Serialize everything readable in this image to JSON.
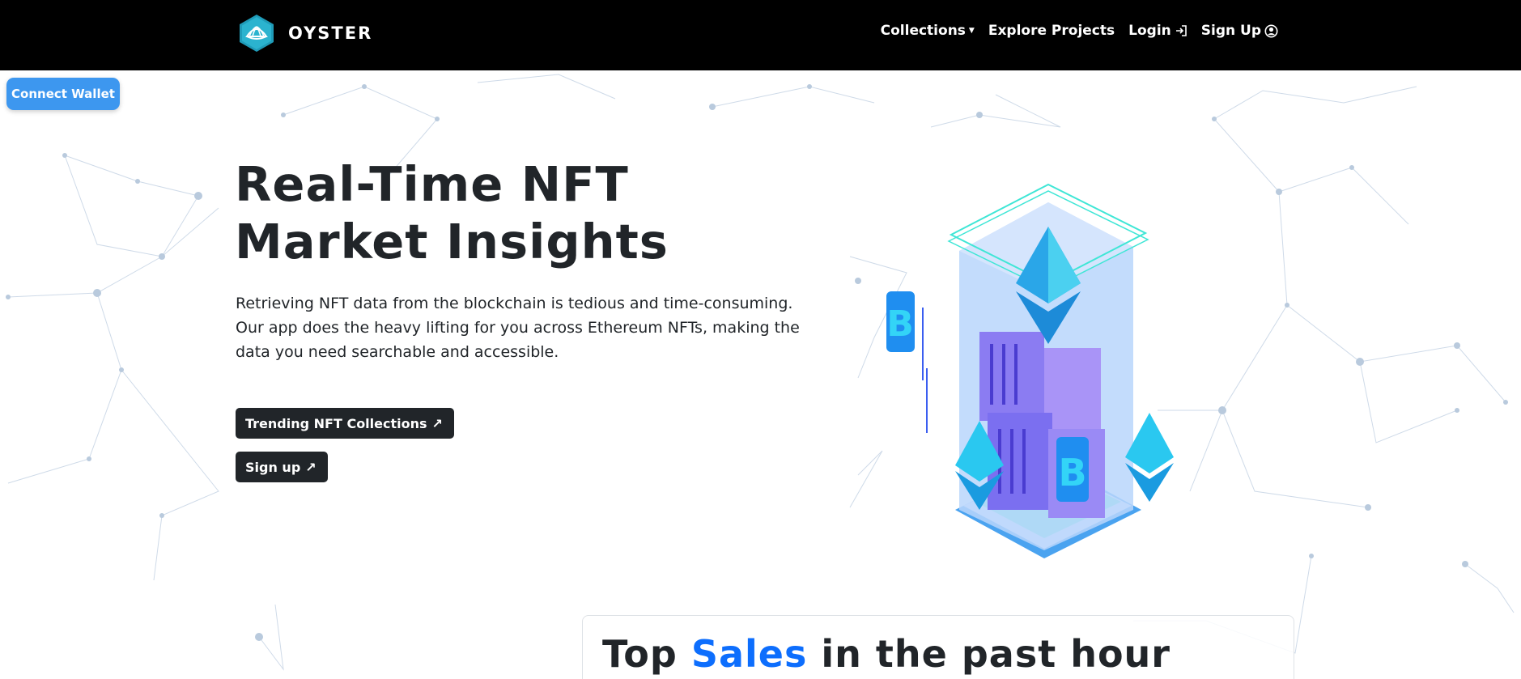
{
  "brand": {
    "name": "OYSTER",
    "logo_icon": "oyster-shell-icon"
  },
  "nav": {
    "collections": "Collections",
    "explore": "Explore Projects",
    "login": "Login",
    "signup": "Sign Up",
    "login_icon": "login-arrow-icon",
    "signup_icon": "user-circle-icon"
  },
  "wallet": {
    "label": "Connect Wallet"
  },
  "hero": {
    "title_line1": "Real-Time NFT",
    "title_line2": "Market Insights",
    "text": "Retrieving NFT data from the blockchain is tedious and time-consuming. Our app does the heavy lifting for you across Ethereum NFTs, making the data you need searchable and accessible.",
    "btn_trending": "Trending NFT Collections",
    "btn_signup": "Sign up",
    "btn_arrow": "↗"
  },
  "sales": {
    "prefix": "Top ",
    "accent": "Sales",
    "suffix": " in the past hour"
  },
  "colors": {
    "nav_bg": "#000000",
    "wallet_btn": "#3d97ef",
    "dark_btn": "#212529",
    "accent": "#0d6efd"
  }
}
